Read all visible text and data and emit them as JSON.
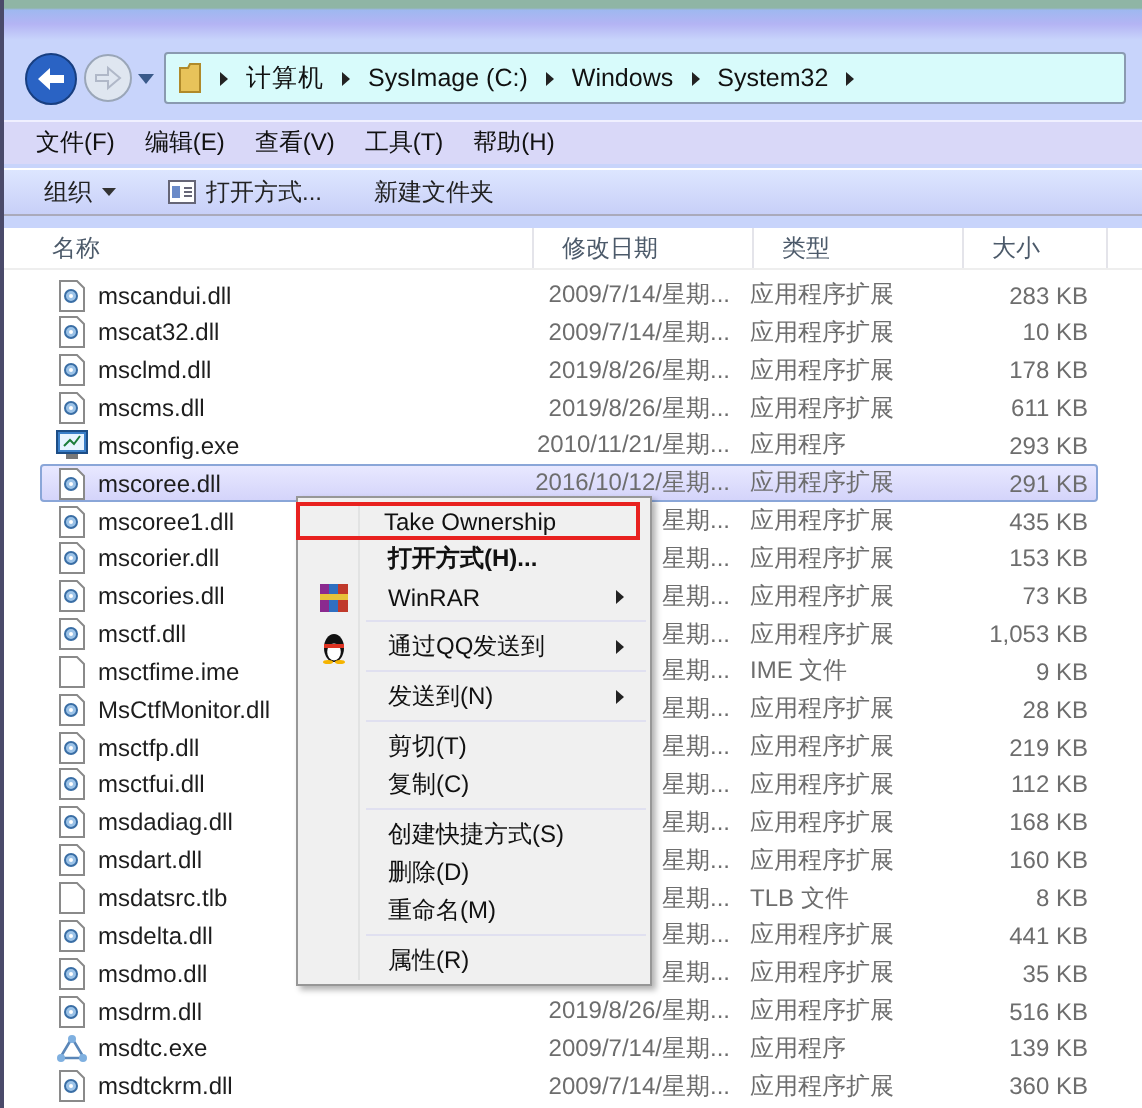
{
  "breadcrumb": [
    "计算机",
    "SysImage (C:)",
    "Windows",
    "System32"
  ],
  "menubar": [
    "文件(F)",
    "编辑(E)",
    "查看(V)",
    "工具(T)",
    "帮助(H)"
  ],
  "toolbar": [
    {
      "label": "组织",
      "kind": "dropdown"
    },
    {
      "label": "打开方式...",
      "kind": "icon"
    },
    {
      "label": "新建文件夹",
      "kind": "plain"
    }
  ],
  "columns": [
    "名称",
    "修改日期",
    "类型",
    "大小"
  ],
  "files": [
    {
      "name": "mscandui.dll",
      "date": "2009/7/14/星期...",
      "type": "应用程序扩展",
      "size": "283 KB",
      "kind": "dll",
      "selected": false
    },
    {
      "name": "mscat32.dll",
      "date": "2009/7/14/星期...",
      "type": "应用程序扩展",
      "size": "10 KB",
      "kind": "dll",
      "selected": false
    },
    {
      "name": "msclmd.dll",
      "date": "2019/8/26/星期...",
      "type": "应用程序扩展",
      "size": "178 KB",
      "kind": "dll",
      "selected": false
    },
    {
      "name": "mscms.dll",
      "date": "2019/8/26/星期...",
      "type": "应用程序扩展",
      "size": "611 KB",
      "kind": "dll",
      "selected": false
    },
    {
      "name": "msconfig.exe",
      "date": "2010/11/21/星期...",
      "type": "应用程序",
      "size": "293 KB",
      "kind": "monitor",
      "selected": false
    },
    {
      "name": "mscoree.dll",
      "date": "2016/10/12/星期...",
      "type": "应用程序扩展",
      "size": "291 KB",
      "kind": "dll",
      "selected": true
    },
    {
      "name": "mscoree1.dll",
      "date": "星期...",
      "type": "应用程序扩展",
      "size": "435 KB",
      "kind": "dll",
      "selected": false
    },
    {
      "name": "mscorier.dll",
      "date": "星期...",
      "type": "应用程序扩展",
      "size": "153 KB",
      "kind": "dll",
      "selected": false
    },
    {
      "name": "mscories.dll",
      "date": "星期...",
      "type": "应用程序扩展",
      "size": "73 KB",
      "kind": "dll",
      "selected": false
    },
    {
      "name": "msctf.dll",
      "date": "星期...",
      "type": "应用程序扩展",
      "size": "1,053 KB",
      "kind": "dll",
      "selected": false
    },
    {
      "name": "msctfime.ime",
      "date": "星期...",
      "type": "IME 文件",
      "size": "9 KB",
      "kind": "blank",
      "selected": false
    },
    {
      "name": "MsCtfMonitor.dll",
      "date": "星期...",
      "type": "应用程序扩展",
      "size": "28 KB",
      "kind": "dll",
      "selected": false
    },
    {
      "name": "msctfp.dll",
      "date": "星期...",
      "type": "应用程序扩展",
      "size": "219 KB",
      "kind": "dll",
      "selected": false
    },
    {
      "name": "msctfui.dll",
      "date": "星期...",
      "type": "应用程序扩展",
      "size": "112 KB",
      "kind": "dll",
      "selected": false
    },
    {
      "name": "msdadiag.dll",
      "date": "星期...",
      "type": "应用程序扩展",
      "size": "168 KB",
      "kind": "dll",
      "selected": false
    },
    {
      "name": "msdart.dll",
      "date": "星期...",
      "type": "应用程序扩展",
      "size": "160 KB",
      "kind": "dll",
      "selected": false
    },
    {
      "name": "msdatsrc.tlb",
      "date": "星期...",
      "type": "TLB 文件",
      "size": "8 KB",
      "kind": "blank",
      "selected": false
    },
    {
      "name": "msdelta.dll",
      "date": "星期...",
      "type": "应用程序扩展",
      "size": "441 KB",
      "kind": "dll",
      "selected": false
    },
    {
      "name": "msdmo.dll",
      "date": "星期...",
      "type": "应用程序扩展",
      "size": "35 KB",
      "kind": "dll",
      "selected": false
    },
    {
      "name": "msdrm.dll",
      "date": "2019/8/26/星期...",
      "type": "应用程序扩展",
      "size": "516 KB",
      "kind": "dll",
      "selected": false
    },
    {
      "name": "msdtc.exe",
      "date": "2009/7/14/星期...",
      "type": "应用程序",
      "size": "139 KB",
      "kind": "service",
      "selected": false
    },
    {
      "name": "msdtckrm.dll",
      "date": "2009/7/14/星期...",
      "type": "应用程序扩展",
      "size": "360 KB",
      "kind": "dll",
      "selected": false
    }
  ],
  "context_menu": [
    {
      "kind": "item",
      "label": "Take Ownership",
      "outlined": true,
      "bold": false,
      "submenu": false
    },
    {
      "kind": "item",
      "label": "打开方式(H)...",
      "outlined": false,
      "bold": true,
      "submenu": false
    },
    {
      "kind": "archive",
      "label": "WinRAR",
      "outlined": false,
      "bold": false,
      "submenu": true
    },
    {
      "kind": "separator"
    },
    {
      "kind": "penguin",
      "label": "通过QQ发送到",
      "outlined": false,
      "bold": false,
      "submenu": true
    },
    {
      "kind": "separator"
    },
    {
      "kind": "item",
      "label": "发送到(N)",
      "outlined": false,
      "bold": false,
      "submenu": true
    },
    {
      "kind": "separator"
    },
    {
      "kind": "item",
      "label": "剪切(T)",
      "outlined": false,
      "bold": false,
      "submenu": false
    },
    {
      "kind": "item",
      "label": "复制(C)",
      "outlined": false,
      "bold": false,
      "submenu": false
    },
    {
      "kind": "separator"
    },
    {
      "kind": "item",
      "label": "创建快捷方式(S)",
      "outlined": false,
      "bold": false,
      "submenu": false
    },
    {
      "kind": "item",
      "label": "删除(D)",
      "outlined": false,
      "bold": false,
      "submenu": false
    },
    {
      "kind": "item",
      "label": "重命名(M)",
      "outlined": false,
      "bold": false,
      "submenu": false
    },
    {
      "kind": "separator"
    },
    {
      "kind": "item",
      "label": "属性(R)",
      "outlined": false,
      "bold": false,
      "submenu": false
    }
  ]
}
